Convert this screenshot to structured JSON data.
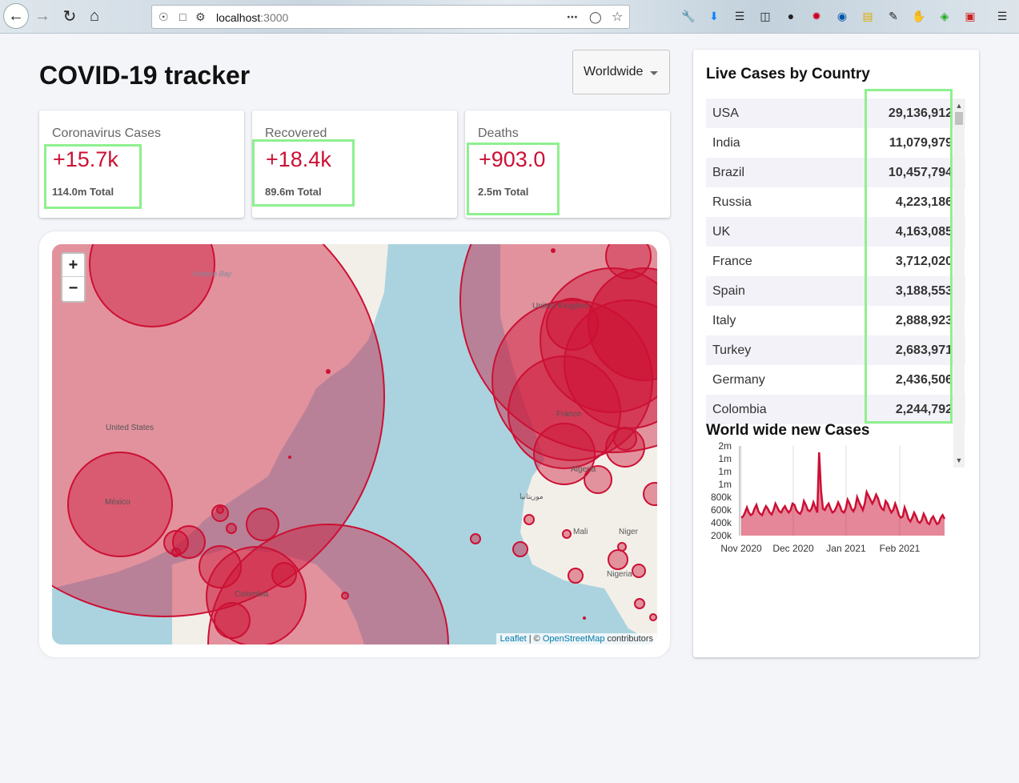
{
  "browser": {
    "url_host": "localhost",
    "url_port": ":3000"
  },
  "header": {
    "title": "COVID-19 tracker",
    "region": "Worldwide"
  },
  "stats": [
    {
      "label": "Coronavirus Cases",
      "today": "+15.7k",
      "total": "114.0m Total"
    },
    {
      "label": "Recovered",
      "today": "+18.4k",
      "total": "89.6m Total"
    },
    {
      "label": "Deaths",
      "today": "+903.0",
      "total": "2.5m Total"
    }
  ],
  "map": {
    "labels": {
      "hudson": "Hudson Bay",
      "us": "United States",
      "mexico": "México",
      "colombia": "Colombia",
      "uk": "United Kingdom",
      "france": "France",
      "algeria": "Algeria",
      "mali": "Mali",
      "niger": "Niger",
      "nigeria": "Nigeria",
      "mauritania": "موريتانيا"
    },
    "zoom_in": "+",
    "zoom_out": "−",
    "attribution_leaflet": "Leaflet",
    "attribution_sep": " | © ",
    "attribution_osm": "OpenStreetMap",
    "attribution_rest": " contributors"
  },
  "sidebar": {
    "title": "Live Cases by Country",
    "countries": [
      {
        "name": "USA",
        "cases": "29,136,912"
      },
      {
        "name": "India",
        "cases": "11,079,979"
      },
      {
        "name": "Brazil",
        "cases": "10,457,794"
      },
      {
        "name": "Russia",
        "cases": "4,223,186"
      },
      {
        "name": "UK",
        "cases": "4,163,085"
      },
      {
        "name": "France",
        "cases": "3,712,020"
      },
      {
        "name": "Spain",
        "cases": "3,188,553"
      },
      {
        "name": "Italy",
        "cases": "2,888,923"
      },
      {
        "name": "Turkey",
        "cases": "2,683,971"
      },
      {
        "name": "Germany",
        "cases": "2,436,506"
      },
      {
        "name": "Colombia",
        "cases": "2,244,792"
      }
    ],
    "chart_title": "World wide new Cases"
  },
  "chart_data": {
    "type": "area",
    "yticks": [
      "2m",
      "1m",
      "1m",
      "1m",
      "800k",
      "600k",
      "400k",
      "200k"
    ],
    "xticks": [
      "Nov 2020",
      "Dec 2020",
      "Jan 2021",
      "Feb 2021"
    ],
    "x_start": "2020-11-01",
    "x_end": "2021-02-28",
    "ylim": [
      200000,
      1600000
    ],
    "color": "#cc1034",
    "values": [
      480000,
      500000,
      560000,
      640000,
      560000,
      520000,
      540000,
      620000,
      680000,
      580000,
      540000,
      520000,
      600000,
      660000,
      620000,
      560000,
      530000,
      600000,
      700000,
      640000,
      580000,
      560000,
      620000,
      660000,
      600000,
      560000,
      600000,
      700000,
      680000,
      600000,
      560000,
      540000,
      600000,
      740000,
      680000,
      600000,
      580000,
      620000,
      720000,
      640000,
      560000,
      1500000,
      900000,
      620000,
      600000,
      660000,
      700000,
      620000,
      560000,
      580000,
      640000,
      720000,
      660000,
      580000,
      560000,
      620000,
      760000,
      700000,
      620000,
      580000,
      640000,
      800000,
      720000,
      660000,
      600000,
      700000,
      880000,
      820000,
      760000,
      700000,
      760000,
      840000,
      780000,
      680000,
      620000,
      600000,
      740000,
      700000,
      620000,
      560000,
      600000,
      700000,
      620000,
      520000,
      480000,
      500000,
      640000,
      560000,
      460000,
      420000,
      480000,
      560000,
      500000,
      420000,
      400000,
      440000,
      540000,
      480000,
      400000,
      380000,
      460000,
      500000,
      440000,
      380000,
      400000,
      480000,
      520000,
      460000
    ]
  }
}
